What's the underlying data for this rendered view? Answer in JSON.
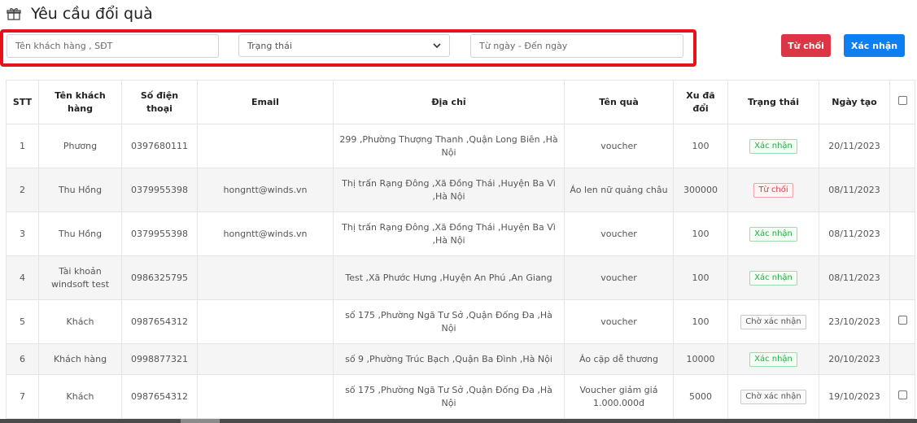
{
  "header": {
    "title": "Yêu cầu đổi quà",
    "icon": "gift-icon"
  },
  "filters": {
    "name_placeholder": "Tên khách hàng , SĐT",
    "status_value": "Trạng thái",
    "date_placeholder": "Từ ngày - Đến ngày"
  },
  "actions": {
    "reject_label": "Từ chối",
    "approve_label": "Xác nhận"
  },
  "colors": {
    "reject": "#dc3545",
    "approve": "#0d7ff0",
    "highlight_border": "#e5141b"
  },
  "table": {
    "headers": {
      "stt": "STT",
      "name": "Tên khách hàng",
      "phone": "Số điện thoại",
      "email": "Email",
      "address": "Địa chỉ",
      "gift": "Tên quà",
      "coins": "Xu đã đổi",
      "status": "Trạng thái",
      "created": "Ngày tạo"
    },
    "rows": [
      {
        "stt": "1",
        "name": "Phương",
        "phone": "0397680111",
        "email": "",
        "address": "299 ,Phường Thượng Thanh ,Quận Long Biên ,Hà Nội",
        "gift": "voucher",
        "coins": "100",
        "status": "Xác nhận",
        "created": "20/11/2023"
      },
      {
        "stt": "2",
        "name": "Thu Hồng",
        "phone": "0379955398",
        "email": "hongntt@winds.vn",
        "address": "Thị trấn Rạng Đông ,Xã Đồng Thái ,Huyện Ba Vì ,Hà Nội",
        "gift": "Áo len nữ quảng châu",
        "coins": "300000",
        "status": "Từ chối",
        "created": "08/11/2023"
      },
      {
        "stt": "3",
        "name": "Thu Hồng",
        "phone": "0379955398",
        "email": "hongntt@winds.vn",
        "address": "Thị trấn Rạng Đông ,Xã Đồng Thái ,Huyện Ba Vì ,Hà Nội",
        "gift": "voucher",
        "coins": "100",
        "status": "Xác nhận",
        "created": "08/11/2023"
      },
      {
        "stt": "4",
        "name": "Tài khoản windsoft test",
        "phone": "0986325795",
        "email": "",
        "address": "Test ,Xã Phước Hưng ,Huyện An Phú ,An Giang",
        "gift": "voucher",
        "coins": "100",
        "status": "Xác nhận",
        "created": "08/11/2023"
      },
      {
        "stt": "5",
        "name": "Khách",
        "phone": "0987654312",
        "email": "",
        "address": "số 175 ,Phường Ngã Tư Sở ,Quận Đống Đa ,Hà Nội",
        "gift": "voucher",
        "coins": "100",
        "status": "Chờ xác nhận",
        "created": "23/10/2023"
      },
      {
        "stt": "6",
        "name": "Khách hàng",
        "phone": "0998877321",
        "email": "",
        "address": "số 9 ,Phường Trúc Bạch ,Quận Ba Đình ,Hà Nội",
        "gift": "Áo cặp dễ thương",
        "coins": "10000",
        "status": "Xác nhận",
        "created": "20/10/2023"
      },
      {
        "stt": "7",
        "name": "Khách",
        "phone": "0987654312",
        "email": "",
        "address": "số 175 ,Phường Ngã Tư Sở ,Quận Đống Đa ,Hà Nội",
        "gift": "Voucher giảm giá 1.000.000đ",
        "coins": "5000",
        "status": "Chờ xác nhận",
        "created": "19/10/2023"
      }
    ]
  }
}
